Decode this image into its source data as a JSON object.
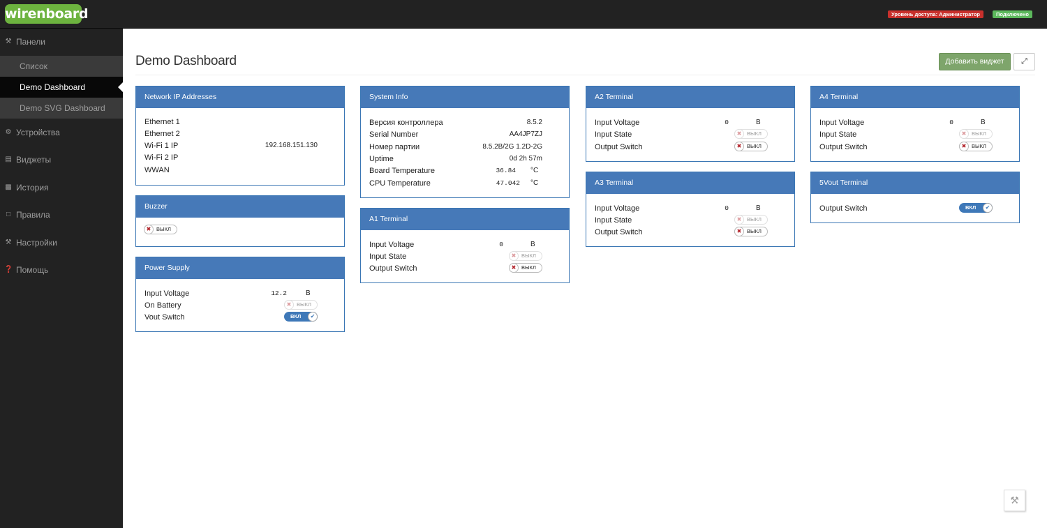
{
  "app": {
    "logo": "wirenboard"
  },
  "header": {
    "access_badge": "Уровень доступа: Администратор",
    "status_badge": "Подключено"
  },
  "sidebar": {
    "panels": {
      "label": "Панели",
      "icon": "wrench-icon"
    },
    "sub_items": [
      "Список",
      "Demo Dashboard",
      "Demo SVG Dashboard"
    ],
    "active_sub": "Demo Dashboard",
    "items": [
      {
        "label": "Устройства",
        "icon": "gear-icon"
      },
      {
        "label": "Виджеты",
        "icon": "list-icon"
      },
      {
        "label": "История",
        "icon": "bar-chart-icon"
      },
      {
        "label": "Правила",
        "icon": "file-icon"
      },
      {
        "label": "Настройки",
        "icon": "wrench-icon"
      },
      {
        "label": "Помощь",
        "icon": "question-icon"
      }
    ]
  },
  "main": {
    "title": "Demo Dashboard",
    "add_widget_label": "Добавить виджет"
  },
  "toggle_labels": {
    "off": "ВЫКЛ",
    "on": "ВКЛ"
  },
  "widgets": {
    "network": {
      "title": "Network IP Addresses",
      "rows": [
        {
          "label": "Ethernet 1",
          "value": ""
        },
        {
          "label": "Ethernet 2",
          "value": ""
        },
        {
          "label": "Wi-Fi 1 IP",
          "value": "192.168.151.130"
        },
        {
          "label": "Wi-Fi 2 IP",
          "value": ""
        },
        {
          "label": "WWAN",
          "value": ""
        }
      ]
    },
    "buzzer": {
      "title": "Buzzer",
      "state": "off"
    },
    "power": {
      "title": "Power Supply",
      "input_voltage_label": "Input Voltage",
      "input_voltage": "12.2",
      "unit": "В",
      "on_battery_label": "On Battery",
      "vout_label": "Vout Switch"
    },
    "system": {
      "title": "System Info",
      "rows": [
        {
          "label": "Версия контроллера",
          "value": "8.5.2"
        },
        {
          "label": "Serial Number",
          "value": "AA4JP7ZJ"
        },
        {
          "label": "Номер партии",
          "value": "8.5.2B/2G 1.2D-2G"
        },
        {
          "label": "Uptime",
          "value": "0d 2h 57m"
        }
      ],
      "board_temp_label": "Board Temperature",
      "board_temp": "36.84",
      "cpu_temp_label": "CPU Temperature",
      "cpu_temp": "47.042",
      "temp_unit": "°C"
    },
    "a1": {
      "title": "A1 Terminal",
      "voltage": "0",
      "unit": "В"
    },
    "a2": {
      "title": "A2 Terminal",
      "voltage": "0",
      "unit": "В"
    },
    "a3": {
      "title": "A3 Terminal",
      "voltage": "0",
      "unit": "В"
    },
    "a4": {
      "title": "A4 Terminal",
      "voltage": "0",
      "unit": "В"
    },
    "vout5": {
      "title": "5Vout Terminal",
      "label": "Output Switch"
    },
    "terminal_labels": {
      "voltage": "Input Voltage",
      "state": "Input State",
      "switch": "Output Switch"
    }
  }
}
